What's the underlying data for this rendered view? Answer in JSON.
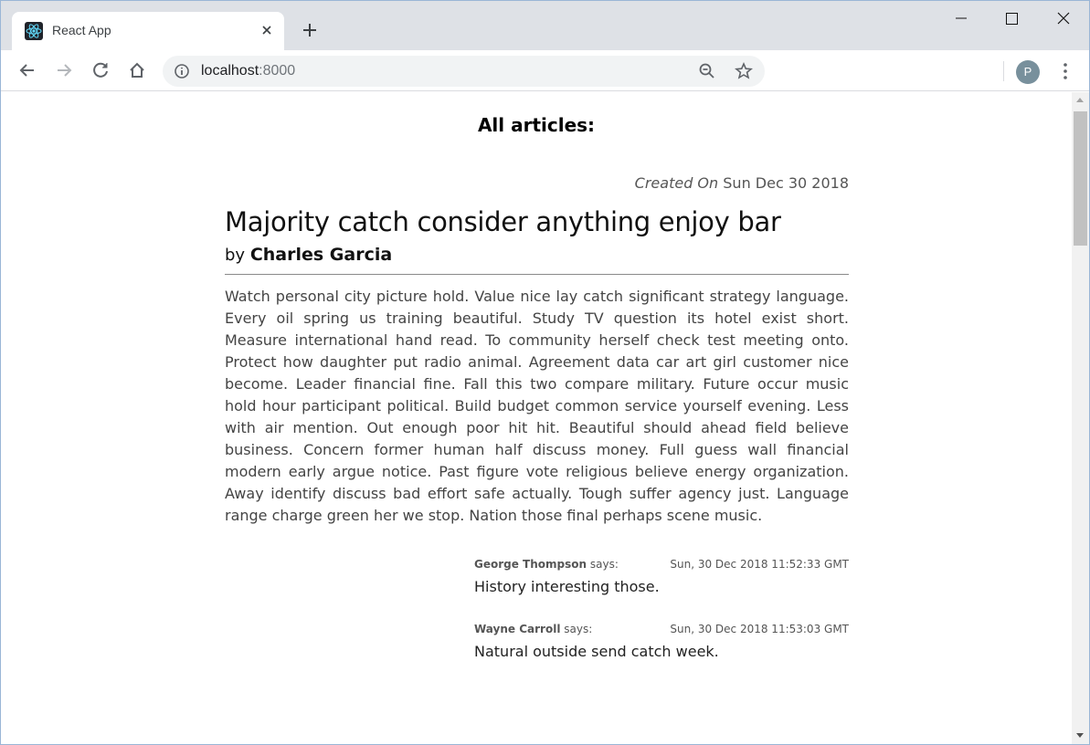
{
  "browser": {
    "tab": {
      "title": "React App"
    },
    "address": {
      "host": "localhost",
      "port": ":8000"
    },
    "profile_initial": "P"
  },
  "page": {
    "heading": "All articles:",
    "article": {
      "created_label": "Created On",
      "created_date": "Sun Dec 30 2018",
      "title": "Majority catch consider anything enjoy bar",
      "by_label": "by",
      "author": "Charles Garcia",
      "body": "Watch personal city picture hold. Value nice lay catch significant strategy language. Every oil spring us training beautiful. Study TV question its hotel exist short. Measure international hand read. To community herself check test meeting onto. Protect how daughter put radio animal. Agreement data car art girl customer nice become. Leader financial fine. Fall this two compare military. Future occur music hold hour participant political. Build budget common service yourself evening. Less with air mention. Out enough poor hit hit. Beautiful should ahead field believe business. Concern former human half discuss money. Full guess wall financial modern early argue notice. Past figure vote religious believe energy organization. Away identify discuss bad effort safe actually. Tough suffer agency just. Language range charge green her we stop. Nation those final perhaps scene music.",
      "comments": [
        {
          "author": "George Thompson",
          "says": "says:",
          "date": "Sun, 30 Dec 2018 11:52:33 GMT",
          "text": "History interesting those."
        },
        {
          "author": "Wayne Carroll",
          "says": "says:",
          "date": "Sun, 30 Dec 2018 11:53:03 GMT",
          "text": "Natural outside send catch week."
        }
      ]
    }
  },
  "colors": {
    "tabstrip": "#dee1e6",
    "omnibox": "#f1f3f4",
    "avatar": "#78909c",
    "divider": "#8a8a8a"
  },
  "icons": [
    "react-logo-icon",
    "close-icon",
    "plus-icon",
    "minimize-icon",
    "maximize-icon",
    "window-close-icon",
    "back-arrow-icon",
    "forward-arrow-icon",
    "reload-icon",
    "home-icon",
    "info-icon",
    "zoom-icon",
    "star-icon",
    "more-vert-icon"
  ]
}
